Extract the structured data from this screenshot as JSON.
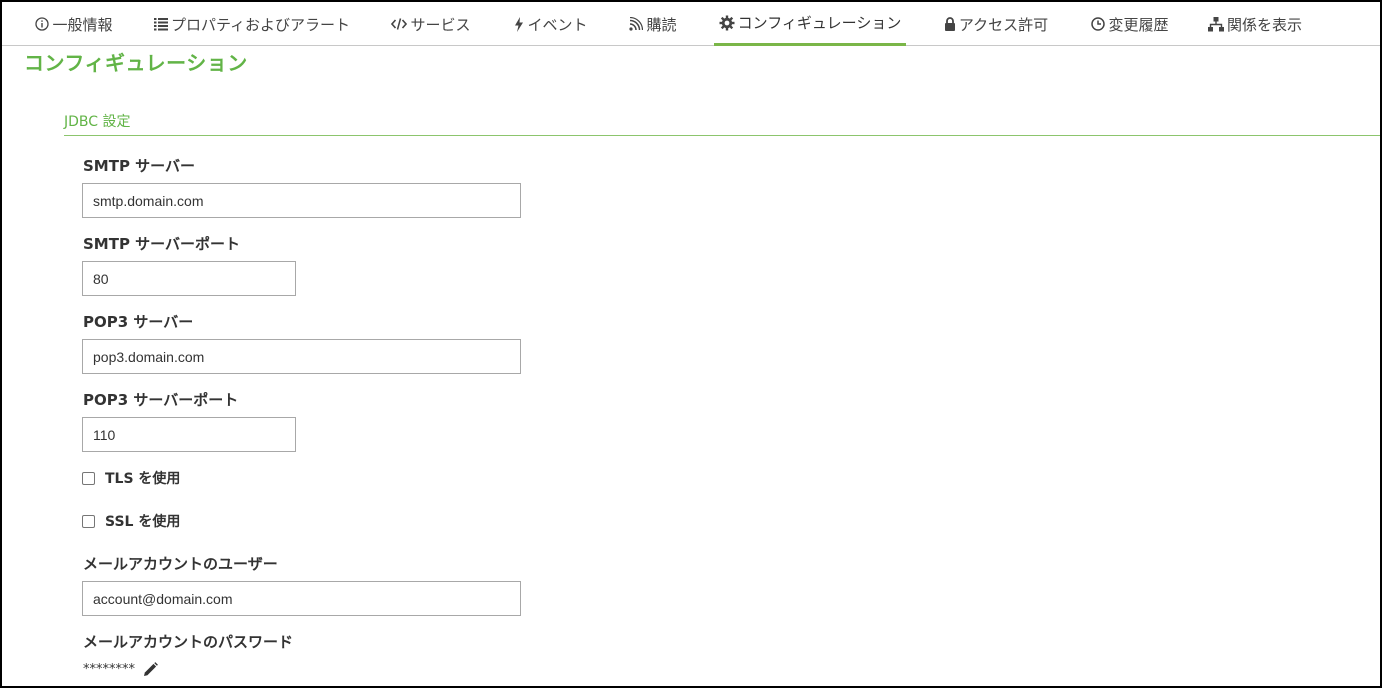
{
  "tabs": [
    {
      "label": "一般情報",
      "icon": "info-icon"
    },
    {
      "label": "プロパティおよびアラート",
      "icon": "list-icon"
    },
    {
      "label": "サービス",
      "icon": "code-icon"
    },
    {
      "label": "イベント",
      "icon": "bolt-icon"
    },
    {
      "label": "購読",
      "icon": "rss-icon"
    },
    {
      "label": "コンフィギュレーション",
      "icon": "gear-icon",
      "active": true
    },
    {
      "label": "アクセス許可",
      "icon": "lock-icon"
    },
    {
      "label": "変更履歴",
      "icon": "clock-icon"
    },
    {
      "label": "関係を表示",
      "icon": "sitemap-icon"
    }
  ],
  "page": {
    "title": "コンフィギュレーション",
    "section": "JDBC 設定"
  },
  "form": {
    "smtp_server": {
      "label": "SMTP サーバー",
      "value": "smtp.domain.com"
    },
    "smtp_port": {
      "label": "SMTP サーバーポート",
      "value": "80"
    },
    "pop3_server": {
      "label": "POP3 サーバー",
      "value": "pop3.domain.com"
    },
    "pop3_port": {
      "label": "POP3 サーバーポート",
      "value": "110"
    },
    "use_tls": {
      "label": "TLS を使用",
      "checked": false
    },
    "use_ssl": {
      "label": "SSL を使用",
      "checked": false
    },
    "mail_user": {
      "label": "メールアカウントのユーザー",
      "value": "account@domain.com"
    },
    "mail_password": {
      "label": "メールアカウントのパスワード",
      "value": "********",
      "edit_icon": "pencil-icon"
    }
  },
  "colors": {
    "accent": "#62b447",
    "tab_underline": "#7ab648",
    "border": "#a8a8a8"
  }
}
